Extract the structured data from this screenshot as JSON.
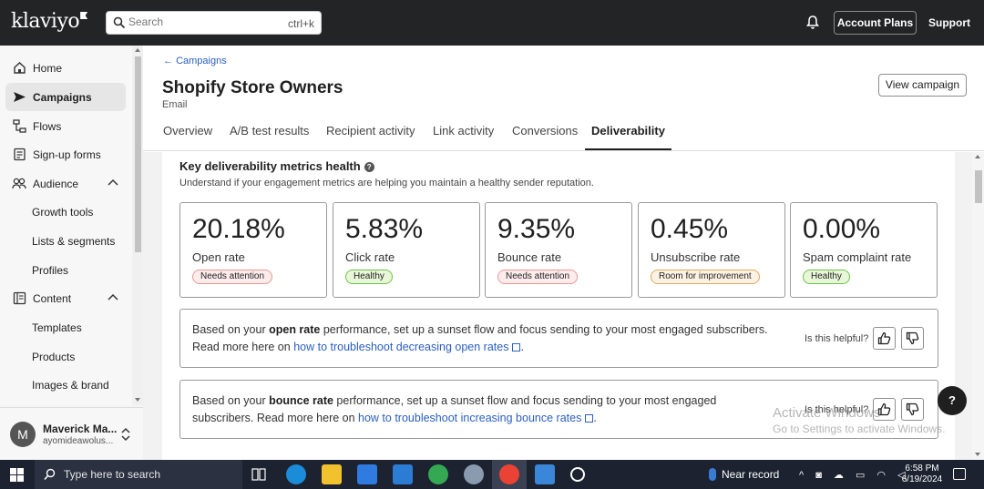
{
  "topbar": {
    "logo": "klaviyo",
    "search_placeholder": "Search",
    "search_shortcut": "ctrl+k",
    "account_plans": "Account Plans",
    "support": "Support"
  },
  "sidebar": {
    "items": [
      {
        "label": "Home",
        "icon": "home-icon"
      },
      {
        "label": "Campaigns",
        "icon": "send-icon",
        "active": true
      },
      {
        "label": "Flows",
        "icon": "flow-icon"
      },
      {
        "label": "Sign-up forms",
        "icon": "form-icon"
      },
      {
        "label": "Audience",
        "icon": "people-icon",
        "expanded": true
      },
      {
        "label": "Content",
        "icon": "content-icon",
        "expanded": true
      }
    ],
    "audience_sub": [
      "Growth tools",
      "Lists & segments",
      "Profiles"
    ],
    "content_sub": [
      "Templates",
      "Products",
      "Images & brand"
    ],
    "user": {
      "initial": "M",
      "name": "Maverick Ma...",
      "email": "ayomideawolus..."
    }
  },
  "page": {
    "back_label": "Campaigns",
    "title": "Shopify Store Owners",
    "subtitle": "Email",
    "view_campaign": "View campaign",
    "tabs": [
      "Overview",
      "A/B test results",
      "Recipient activity",
      "Link activity",
      "Conversions",
      "Deliverability"
    ],
    "active_tab": "Deliverability"
  },
  "health": {
    "heading": "Key deliverability metrics health",
    "subheading": "Understand if your engagement metrics are helping you maintain a healthy sender reputation.",
    "metrics": [
      {
        "value": "20.18%",
        "label": "Open rate",
        "badge": "Needs attention",
        "status": "attention"
      },
      {
        "value": "5.83%",
        "label": "Click rate",
        "badge": "Healthy",
        "status": "healthy"
      },
      {
        "value": "9.35%",
        "label": "Bounce rate",
        "badge": "Needs attention",
        "status": "attention"
      },
      {
        "value": "0.45%",
        "label": "Unsubscribe rate",
        "badge": "Room for improvement",
        "status": "improvement"
      },
      {
        "value": "0.00%",
        "label": "Spam complaint rate",
        "badge": "Healthy",
        "status": "healthy"
      }
    ],
    "tips": [
      {
        "pre": "Based on your ",
        "metric": "open rate",
        "post": " performance, set up a sunset flow and focus sending to your most engaged subscribers. Read more here on ",
        "link": "how to troubleshoot decreasing open rates",
        "end": "."
      },
      {
        "pre": "Based on your ",
        "metric": "bounce rate",
        "post": " performance, set up a sunset flow and focus sending to your most engaged subscribers. Read more here on ",
        "link": "how to troubleshoot increasing bounce rates",
        "end": "."
      }
    ],
    "helpful_label": "Is this helpful?"
  },
  "float_help": "?",
  "watermark": {
    "line1": "Activate Windows",
    "line2": "Go to Settings to activate Windows."
  },
  "taskbar": {
    "search_placeholder": "Type here to search",
    "weather": "Near record",
    "time": "6:58 PM",
    "date": "6/19/2024"
  },
  "colors": {
    "topbar": "#232426",
    "link": "#2a5fbf",
    "attention_border": "#e69994",
    "healthy_border": "#6cc24a",
    "improvement_border": "#e0a85a"
  }
}
